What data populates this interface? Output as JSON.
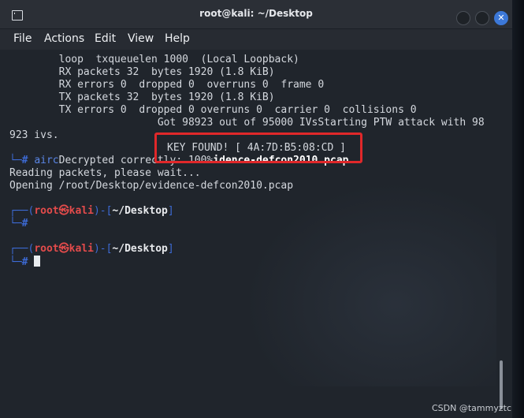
{
  "window": {
    "title": "root@kali: ~/Desktop"
  },
  "menu": [
    "File",
    "Actions",
    "Edit",
    "View",
    "Help"
  ],
  "terminal": {
    "lines": [
      "        loop  txqueuelen 1000  (Local Loopback)",
      "        RX packets 32  bytes 1920 (1.8 KiB)",
      "        RX errors 0  dropped 0  overruns 0  frame 0",
      "        TX packets 32  bytes 1920 (1.8 KiB)",
      "        TX errors 0  dropped 0 overruns 0  carrier 0  collisions 0",
      "                        Got 98923 out of 95000 IVsStarting PTW attack with 98",
      "923 ivs."
    ],
    "key_found": "KEY FOUND! [ 4A:7D:B5:08:CD ]",
    "cmd_prompt_marker": "└─",
    "hash": "#",
    "cmd_start": "airc",
    "decrypted_text": "Decrypted correctly: 100%",
    "decrypted_tail": "idence-defcon2010.pcap",
    "reading": "Reading packets, please wait...",
    "opening": "Opening /root/Desktop/evidence-defcon2010.pcap",
    "prompt": {
      "open": "┌──(",
      "user": "root㉿kali",
      "mid": ")-[",
      "path": "~/Desktop",
      "close": "]",
      "end": "└─"
    }
  },
  "watermark": "CSDN @tammyztc"
}
